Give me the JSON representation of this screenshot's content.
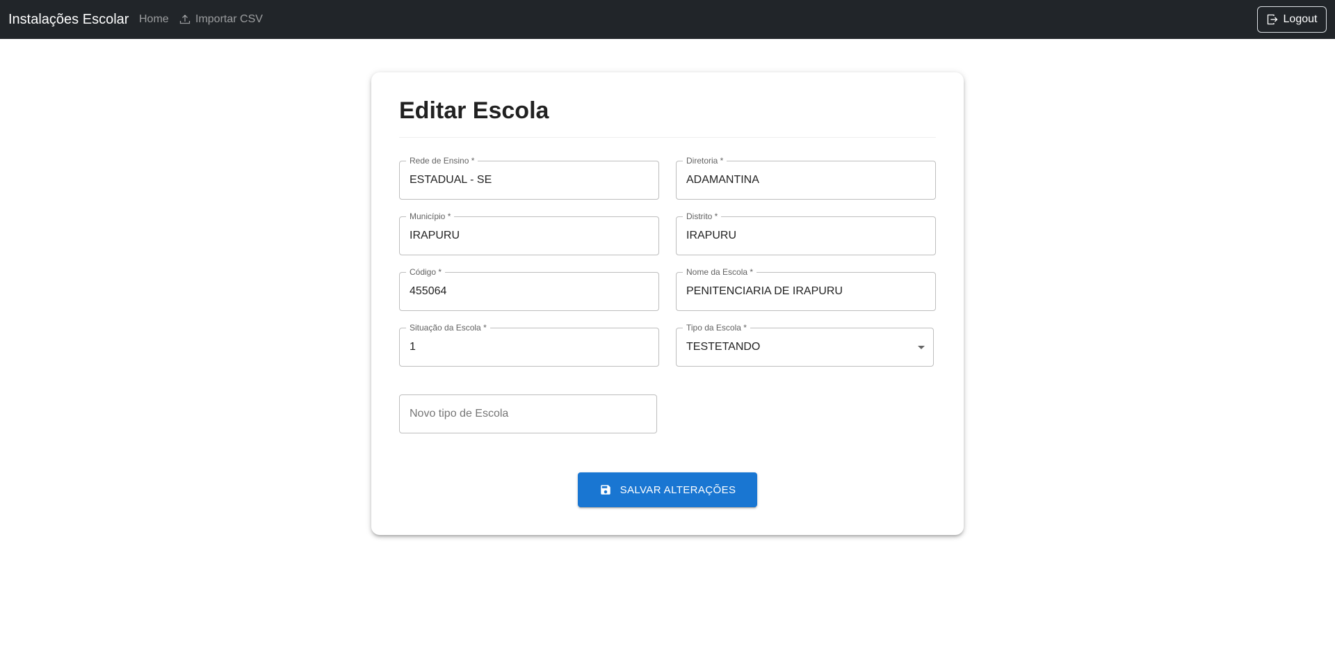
{
  "navbar": {
    "brand": "Instalações Escolar",
    "home": "Home",
    "import_csv": "Importar CSV",
    "logout": "Logout"
  },
  "form": {
    "title": "Editar Escola",
    "fields": {
      "rede": {
        "label": "Rede de Ensino *",
        "value": "ESTADUAL - SE"
      },
      "diretoria": {
        "label": "Diretoria *",
        "value": "ADAMANTINA"
      },
      "municipio": {
        "label": "Município *",
        "value": "IRAPURU"
      },
      "distrito": {
        "label": "Distrito *",
        "value": "IRAPURU"
      },
      "codigo": {
        "label": "Código *",
        "value": "455064"
      },
      "nome": {
        "label": "Nome da Escola *",
        "value": "PENITENCIARIA DE IRAPURU"
      },
      "situacao": {
        "label": "Situação da Escola *",
        "value": "1"
      },
      "tipo": {
        "label": "Tipo da Escola *",
        "value": "TESTETANDO"
      },
      "novo_tipo": {
        "placeholder": "Novo tipo de Escola"
      }
    },
    "save_label": "SALVAR ALTERAÇÕES"
  },
  "colors": {
    "navbar_bg": "#212529",
    "primary": "#1976d2"
  },
  "icons": {
    "import": "upload-icon",
    "logout": "logout-icon",
    "save": "save-icon",
    "select": "chevron-down-icon"
  }
}
